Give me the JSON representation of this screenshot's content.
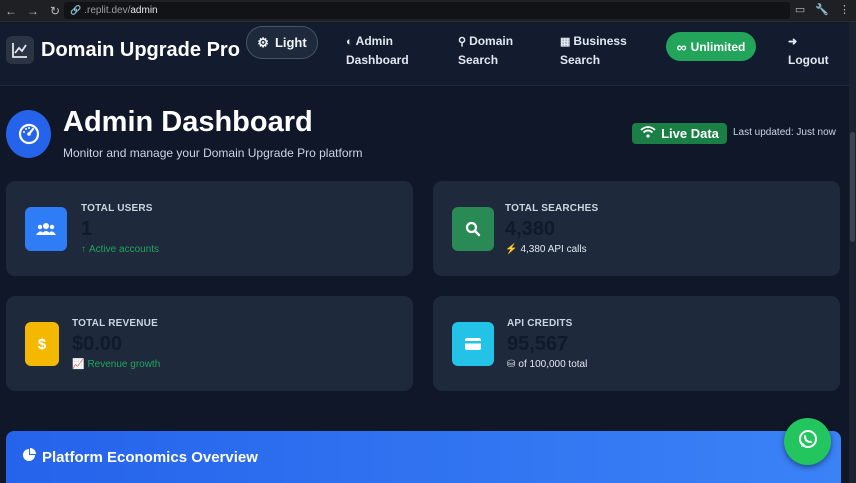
{
  "browser": {
    "url_prefix": ".replit.dev/",
    "url_path": "admin"
  },
  "nav": {
    "brand": "Domain Upgrade Pro",
    "theme_toggle": "Light",
    "admin_line1": "Admin",
    "admin_line2": "Dashboard",
    "domain_line1": "Domain",
    "domain_line2": "Search",
    "business_line1": "Business",
    "business_line2": "Search",
    "plan_badge": "Unlimited",
    "logout": "Logout"
  },
  "header": {
    "title": "Admin Dashboard",
    "subtitle": "Monitor and manage your Domain Upgrade Pro platform",
    "live_badge": "Live Data",
    "last_updated": "Last updated: Just now"
  },
  "stats": {
    "users": {
      "label": "TOTAL USERS",
      "value": "1",
      "note": "Active accounts",
      "color": "#2563eb"
    },
    "searches": {
      "label": "TOTAL SEARCHES",
      "value": "4,380",
      "note": "4,380 API calls",
      "color": "#22804f"
    },
    "revenue": {
      "label": "TOTAL REVENUE",
      "value": "$0.00",
      "note": "Revenue growth",
      "color": "#f5b800"
    },
    "credits": {
      "label": "API CREDITS",
      "value": "95,567",
      "note": "of 100,000 total",
      "color": "#22c3e6"
    }
  },
  "section": {
    "title": "Platform Economics Overview"
  },
  "colors": {
    "background": "#0f1729",
    "card": "#1e293b",
    "accent_blue": "#2563eb",
    "green": "#22a55b"
  }
}
